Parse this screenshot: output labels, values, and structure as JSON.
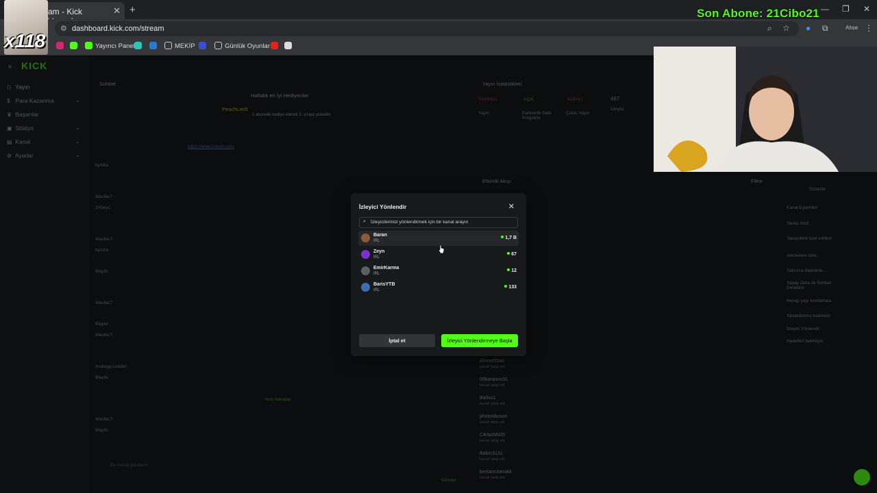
{
  "browser": {
    "tab_title": "Stream - Kick Dashboard",
    "url": "dashboard.kick.com/stream",
    "bookmarks": [
      "Yayıncı Paneli",
      "MEKİP",
      "Günlük Oyunlar"
    ]
  },
  "overlay": {
    "subscriber_text": "Son Abone: 21Cibo21",
    "multiplier": "x118"
  },
  "nav": {
    "items": [
      "Yayın",
      "Para Kazanma",
      "Başarılar",
      "Stüdyo",
      "Kanal",
      "Ayarlar"
    ]
  },
  "chat": {
    "title": "Sohbet",
    "top_gifters": "Haftalık en İyi Hediyeciler",
    "gifter_name": "PeachLes5",
    "gifter_count": "5",
    "gift_hint": "1 abonelik hediye ederek 3. sıraya yükselin",
    "pinned_link": "https://www.jrokez.com/",
    "new_messages": "Yeni mesajlar",
    "input_placeholder": "Bir mesaj gönderin",
    "send_label": "Gönder",
    "users": [
      "byAtra:",
      "Wasfec7:",
      "2Ybeyc:",
      "Wasfec7:",
      "byAtra:",
      "Blaytic",
      "Wasfec7:",
      "Blaytic",
      "Wasfec7:",
      "Avalugg Leader:",
      "Blaytic",
      "Wasfec7:",
      "Blaytic"
    ]
  },
  "stats": {
    "title": "Yayın İstatistikleri",
    "badges": [
      "YAYINDA",
      "AÇIK",
      "KAPALI"
    ],
    "labels": [
      "Yayın",
      "Partnerlik Gelir Programı",
      "Çoklu Yayın",
      "İzleyici"
    ],
    "viewers": "467"
  },
  "activity": {
    "title": "Etkinlik Akışı",
    "filter": "Filtre",
    "follow_text": "kanalı takip etti",
    "rows": [
      "Ahmet55ad",
      "00baranns31",
      "Batlsu1",
      "photonboson",
      "C4rboNN35",
      "Bakirr3131",
      "berkancitanakk"
    ]
  },
  "side_actions": {
    "edit": "Düzenle",
    "title": "Kanal Eylemleri",
    "items": [
      "Yavaş mod",
      "Takipçilere özel sohbet",
      "Abonelere özel...",
      "Yalnızca ifadelerle...",
      "Yapay Zeka ile Sohbet Denetimi",
      "Hesap yaşı kısıtlaması",
      "Yasaklanmış kelimeler",
      "İzleyici Yönlendir",
      "Hedefleri belirleyin"
    ]
  },
  "modal": {
    "title": "İzleyici Yönlendir",
    "search_placeholder": "İzleyicilerinizi yönlendirmek için bir kanal arayın",
    "channels": [
      {
        "name": "Baran",
        "category": "IRL",
        "viewers": "1,7 B",
        "avatar_color": "#8a5a3a"
      },
      {
        "name": "Zeyn",
        "category": "IRL",
        "viewers": "67",
        "avatar_color": "#7a2fd0"
      },
      {
        "name": "EmirKarma",
        "category": "IRL",
        "viewers": "12",
        "avatar_color": "#5a5f66"
      },
      {
        "name": "BarisYTB",
        "category": "IRL",
        "viewers": "133",
        "avatar_color": "#3b6fb0"
      }
    ],
    "cancel_label": "İptal et",
    "start_label": "İzleyici Yönlendirmeye Başla"
  },
  "colors": {
    "accent": "#53fc18",
    "bg": "#0c0d0e",
    "modal": "#18191b"
  }
}
